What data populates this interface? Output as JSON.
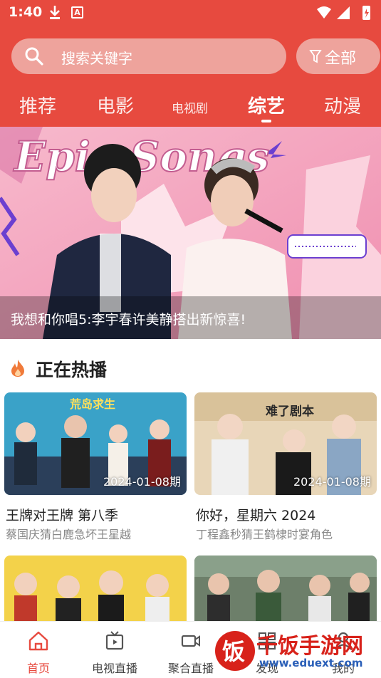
{
  "status": {
    "time": "1:40",
    "icon_a": "A"
  },
  "search": {
    "placeholder": "搜索关键字",
    "filter_label": "全部"
  },
  "tabs": [
    {
      "label": "推荐",
      "active": false
    },
    {
      "label": "电影",
      "active": false
    },
    {
      "label": "电视剧",
      "active": false
    },
    {
      "label": "综艺",
      "active": true
    },
    {
      "label": "动漫",
      "active": false
    }
  ],
  "banner": {
    "artwork_text": "Epic Songs",
    "caption": "我想和你唱5:李宇春许美静搭出新惊喜!"
  },
  "section": {
    "title": "正在热播",
    "icon": "flame-icon"
  },
  "cards": [
    {
      "title": "王牌对王牌 第八季",
      "subtitle": "蔡国庆猜白鹿急坏王星越",
      "badge": "2024-01-08期",
      "thumb_text": "荒岛求生"
    },
    {
      "title": "你好，星期六 2024",
      "subtitle": "丁程鑫秒猜王鹤棣时宴角色",
      "badge": "2024-01-08期",
      "thumb_text": "难了剧本"
    }
  ],
  "bottom_nav": [
    {
      "label": "首页",
      "icon": "home-icon",
      "active": true
    },
    {
      "label": "电视直播",
      "icon": "tv-icon",
      "active": false
    },
    {
      "label": "聚合直播",
      "icon": "video-icon",
      "active": false
    },
    {
      "label": "发现",
      "icon": "discover-icon",
      "active": false
    },
    {
      "label": "我的",
      "icon": "user-icon",
      "active": false
    }
  ],
  "watermark": {
    "brand": "千饭手游网",
    "url": "www.eduext.com",
    "logo_char": "饭"
  },
  "colors": {
    "primary": "#e74a3f",
    "search_bg": "#eea39c"
  }
}
